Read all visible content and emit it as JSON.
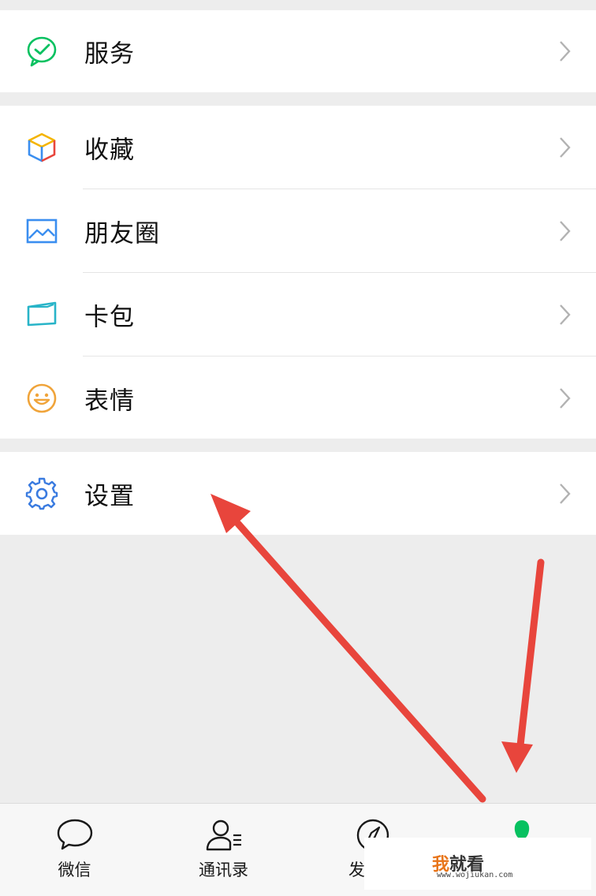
{
  "menu": {
    "services": {
      "label": "服务",
      "icon": "wechat-pay-icon",
      "color": "#07c160"
    },
    "group_two": [
      {
        "label": "收藏",
        "icon": "favorites-cube-icon"
      },
      {
        "label": "朋友圈",
        "icon": "moments-photo-icon"
      },
      {
        "label": "卡包",
        "icon": "card-wallet-icon"
      },
      {
        "label": "表情",
        "icon": "sticker-smile-icon"
      }
    ],
    "settings": {
      "label": "设置",
      "icon": "gear-icon",
      "color": "#3a7be0"
    }
  },
  "tabbar": {
    "tabs": [
      {
        "label": "微信",
        "icon": "chat-bubble-icon"
      },
      {
        "label": "通讯录",
        "icon": "contacts-icon"
      },
      {
        "label": "发",
        "icon": "compass-icon"
      },
      {
        "label": "",
        "icon": "me-person-icon",
        "active": true,
        "color": "#07c160"
      }
    ]
  },
  "annotation": {
    "arrow_color": "#e8453c"
  },
  "watermark": {
    "brand_highlight": "我",
    "brand_rest": "就看",
    "url": "www.wojiukan.com"
  }
}
